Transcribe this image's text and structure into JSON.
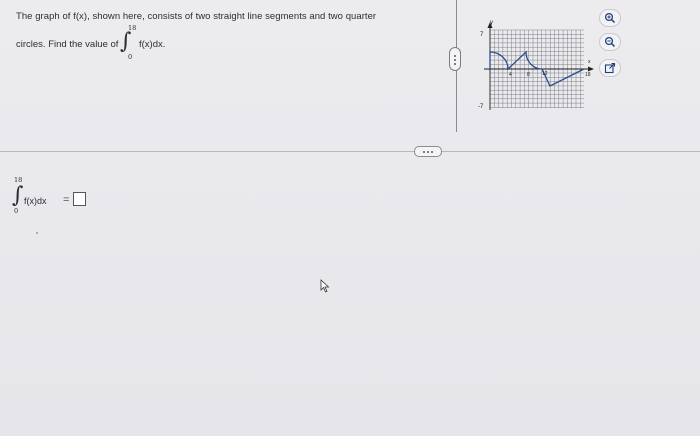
{
  "question": {
    "line1": "The graph of f(x), shown here, consists of two straight line segments and two quarter",
    "line2": "circles. Find the value of",
    "integral_upper": "18",
    "integral_lower": "0",
    "integrand": "f(x)dx."
  },
  "graph": {
    "y_axis_label": "y",
    "x_axis_label": "x",
    "y_top_label": "7",
    "y_bottom_label": "-7",
    "x_ticks": [
      "4",
      "8",
      "12",
      "18"
    ]
  },
  "tools": {
    "zoom_in_icon": "zoom-in-icon",
    "zoom_out_icon": "zoom-out-icon",
    "popout_icon": "external-link-icon"
  },
  "answer": {
    "integral_upper": "18",
    "integral_lower": "0",
    "integrand": "f(x)dx",
    "equals": "=",
    "value": ""
  },
  "colors": {
    "curve": "#2b4c8f",
    "grid": "#7c7c86",
    "text": "#2d2d33"
  }
}
